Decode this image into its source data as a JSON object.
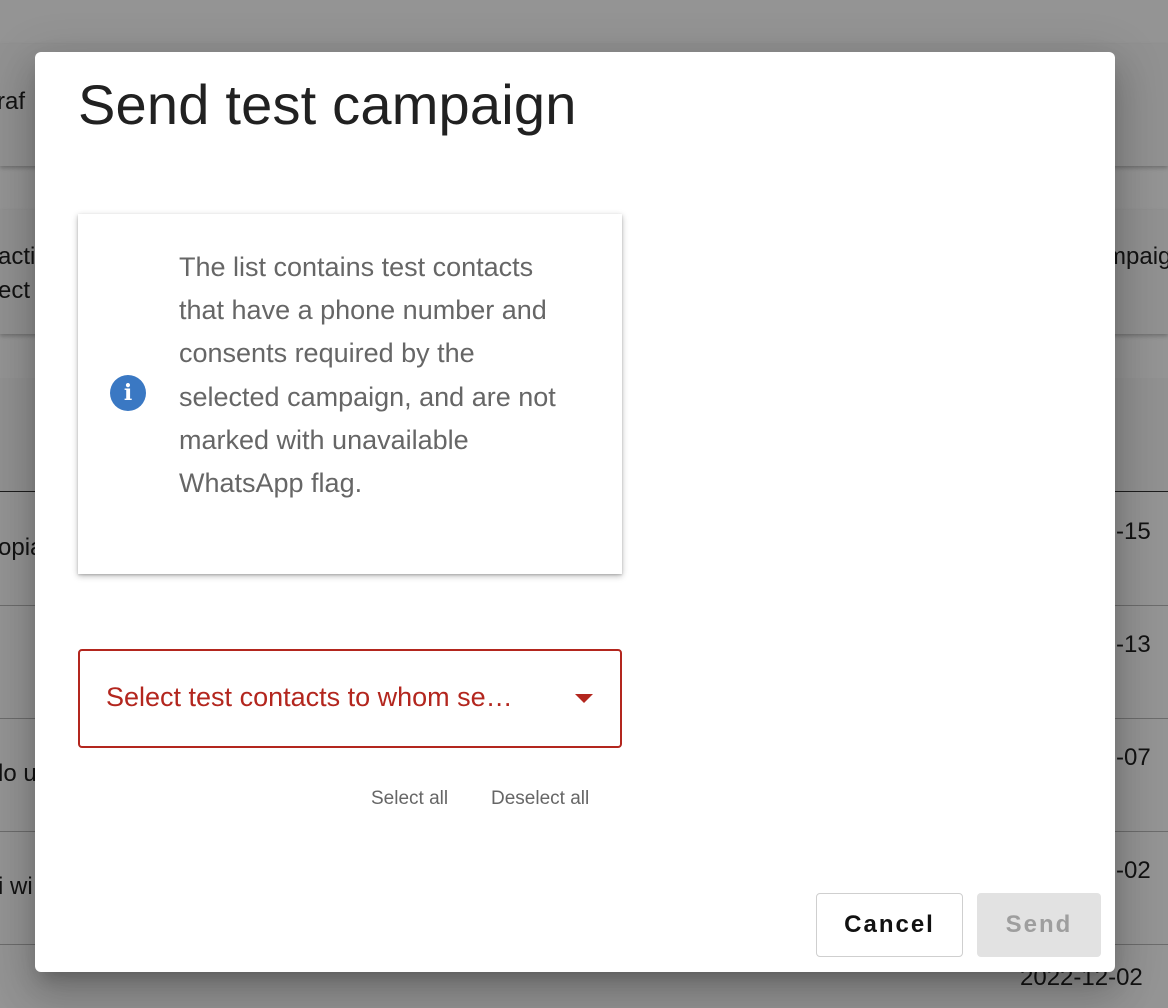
{
  "background": {
    "fragments": [
      "raf",
      "acti",
      "ect",
      "mpaig",
      "opia",
      "lo u",
      "i wi",
      "-15",
      "-13",
      "-07",
      "-02",
      "2022-12-02"
    ]
  },
  "dialog": {
    "title": "Send test campaign",
    "info": {
      "icon": "info-icon",
      "icon_glyph": "i",
      "text": "The list contains test contacts that have a phone number and consents required by the selected campaign, and are not marked with unavailable WhatsApp flag."
    },
    "select": {
      "placeholder": "Select test contacts to whom se…",
      "arrow_icon": "dropdown-arrow-icon"
    },
    "select_all_label": "Select all",
    "deselect_all_label": "Deselect all",
    "cancel_label": "Cancel",
    "send_label": "Send"
  },
  "colors": {
    "error": "#b3261e",
    "info": "#3a78c3",
    "disabled_bg": "#e2e2e2",
    "disabled_text": "#9e9e9e"
  }
}
